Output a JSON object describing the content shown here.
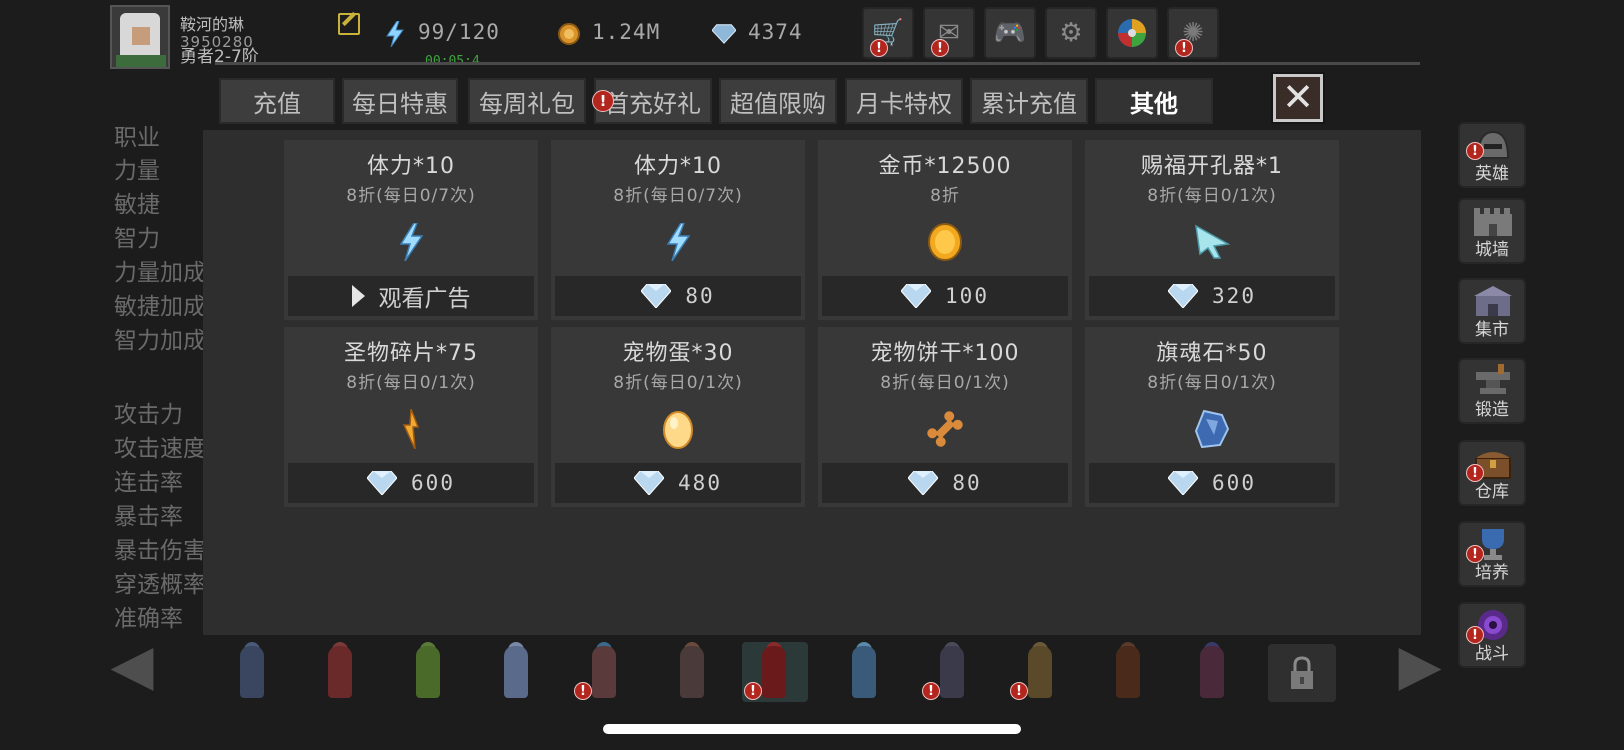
{
  "player": {
    "name": "鞍河的琳",
    "id": "3950280",
    "rank": "勇者2-7阶",
    "timer": "00:05:4"
  },
  "resources": [
    {
      "icon": "energy-icon",
      "value": "99/120"
    },
    {
      "icon": "gold-coin-icon",
      "value": "1.24M"
    },
    {
      "icon": "diamond-icon",
      "value": "4374"
    }
  ],
  "top_buttons": [
    {
      "icon": "shop-cart-icon",
      "alert": true
    },
    {
      "icon": "mail-icon",
      "alert": true
    },
    {
      "icon": "gamepad-icon",
      "alert": false
    },
    {
      "icon": "gear-icon",
      "alert": false
    },
    {
      "icon": "lucky-wheel-icon",
      "alert": false
    },
    {
      "icon": "fireworks-icon",
      "alert": true
    }
  ],
  "stats_labels": [
    "职业",
    "力量",
    "敏捷",
    "智力",
    "力量加成",
    "敏捷加成",
    "智力加成",
    "攻击力",
    "攻击速度",
    "连击率",
    "暴击率",
    "暴击伤害",
    "穿透概率",
    "准确率"
  ],
  "tabs": [
    {
      "label": "充值",
      "active": false,
      "alert": false
    },
    {
      "label": "每日特惠",
      "active": false,
      "alert": false
    },
    {
      "label": "每周礼包",
      "active": false,
      "alert": false
    },
    {
      "label": "首充好礼",
      "active": false,
      "alert": true
    },
    {
      "label": "超值限购",
      "active": false,
      "alert": false
    },
    {
      "label": "月卡特权",
      "active": false,
      "alert": false
    },
    {
      "label": "累计充值",
      "active": false,
      "alert": false
    },
    {
      "label": "其他",
      "active": true,
      "alert": false
    }
  ],
  "items": [
    {
      "title": "体力*10",
      "sub": "8折(每日0/7次)",
      "icon": "energy-icon",
      "price": "观看广告",
      "price_type": "ad"
    },
    {
      "title": "体力*10",
      "sub": "8折(每日0/7次)",
      "icon": "energy-icon",
      "price": "80",
      "price_type": "diamond"
    },
    {
      "title": "金币*12500",
      "sub": "8折",
      "icon": "gold-coin-icon",
      "price": "100",
      "price_type": "diamond"
    },
    {
      "title": "赐福开孔器*1",
      "sub": "8折(每日0/1次)",
      "icon": "drill-icon",
      "price": "320",
      "price_type": "diamond"
    },
    {
      "title": "圣物碎片*75",
      "sub": "8折(每日0/1次)",
      "icon": "relic-shard-icon",
      "price": "600",
      "price_type": "diamond"
    },
    {
      "title": "宠物蛋*30",
      "sub": "8折(每日0/1次)",
      "icon": "pet-egg-icon",
      "price": "480",
      "price_type": "diamond"
    },
    {
      "title": "宠物饼干*100",
      "sub": "8折(每日0/1次)",
      "icon": "bone-biscuit-icon",
      "price": "80",
      "price_type": "diamond"
    },
    {
      "title": "旗魂石*50",
      "sub": "8折(每日0/1次)",
      "icon": "soul-stone-icon",
      "price": "600",
      "price_type": "diamond"
    }
  ],
  "side_nav": [
    {
      "label": "英雄",
      "icon": "hero-helmet-icon",
      "alert": true
    },
    {
      "label": "城墙",
      "icon": "wall-icon",
      "alert": false
    },
    {
      "label": "集市",
      "icon": "market-icon",
      "alert": false
    },
    {
      "label": "锻造",
      "icon": "anvil-icon",
      "alert": false
    },
    {
      "label": "仓库",
      "icon": "chest-icon",
      "alert": true
    },
    {
      "label": "培养",
      "icon": "trophy-icon",
      "alert": true
    },
    {
      "label": "战斗",
      "icon": "portal-icon",
      "alert": true
    }
  ],
  "heroes": [
    {
      "name": "hero-1",
      "alert": false,
      "selected": false
    },
    {
      "name": "hero-2",
      "alert": false,
      "selected": false
    },
    {
      "name": "hero-3",
      "alert": false,
      "selected": false
    },
    {
      "name": "hero-4",
      "alert": false,
      "selected": false
    },
    {
      "name": "hero-5",
      "alert": true,
      "selected": false
    },
    {
      "name": "hero-6",
      "alert": false,
      "selected": false
    },
    {
      "name": "hero-7",
      "alert": true,
      "selected": true
    },
    {
      "name": "hero-8",
      "alert": false,
      "selected": false
    },
    {
      "name": "hero-9",
      "alert": true,
      "selected": false
    },
    {
      "name": "hero-10",
      "alert": true,
      "selected": false
    },
    {
      "name": "hero-11",
      "alert": false,
      "selected": false
    },
    {
      "name": "hero-12",
      "alert": false,
      "selected": false
    }
  ],
  "alert_glyph": "!",
  "close_glyph": "✕",
  "prev_glyph": "◀",
  "next_glyph": "▶"
}
